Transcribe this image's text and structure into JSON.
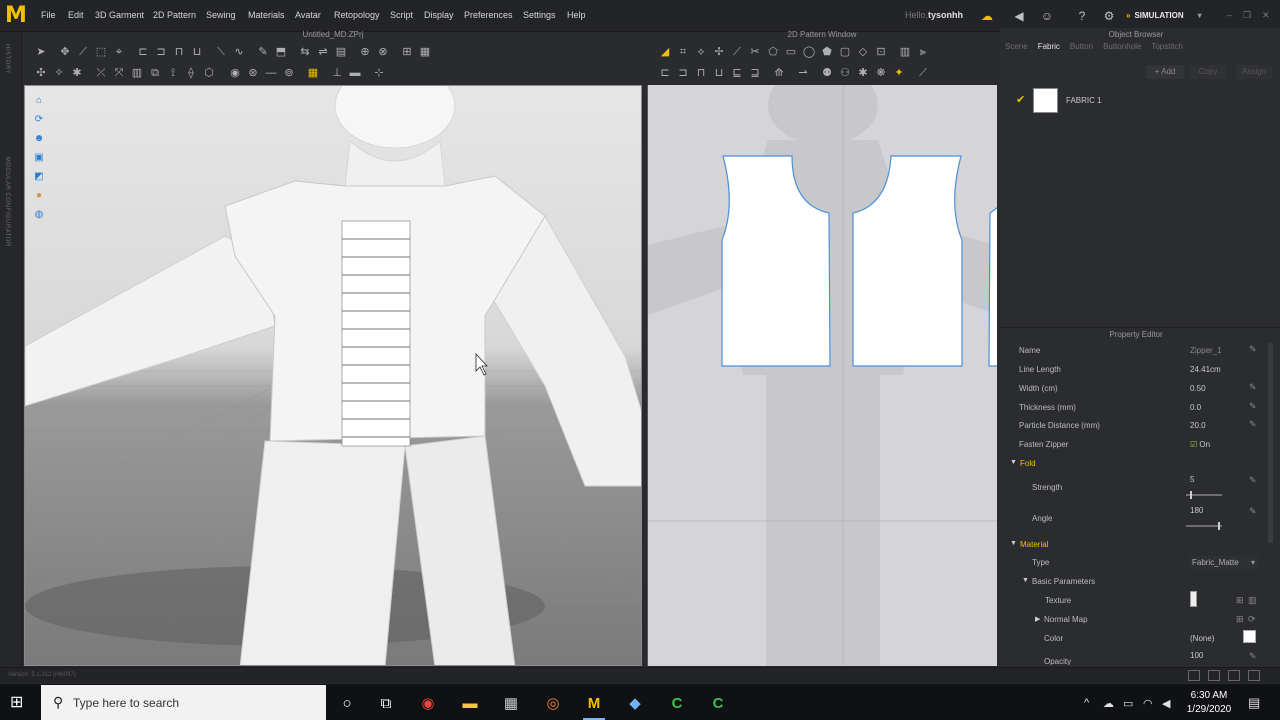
{
  "app": {
    "logo": "M",
    "menu": [
      "File",
      "Edit",
      "3D Garment",
      "2D Pattern",
      "Sewing",
      "Materials",
      "Avatar",
      "Retopology",
      "Script",
      "Display",
      "Preferences",
      "Settings",
      "Help"
    ],
    "greeting": "Hello,",
    "username": "tysonhh",
    "mode_label": "SIMULATION"
  },
  "left_tabs": [
    "HISTORY",
    "MODULAR CONFIGURATOR"
  ],
  "viewport3d": {
    "title": "Untitled_MD.ZPrj"
  },
  "viewport2d": {
    "title": "2D Pattern Window"
  },
  "object_browser": {
    "title": "Object Browser",
    "tabs": [
      "Scene",
      "Fabric",
      "Button",
      "Buttonhole",
      "Topstitch"
    ],
    "active_tab": "Fabric",
    "add_label": "+ Add",
    "copy_label": "Copy",
    "assign_label": "Assign",
    "fabric_item": "FABRIC 1",
    "fabric_color": "#ffffff"
  },
  "property_editor": {
    "title": "Property Editor",
    "name_label": "Name",
    "name_value": "Zipper_1",
    "line_length_label": "Line Length",
    "line_length_value": "24.41cm",
    "width_label": "Width (cm)",
    "width_value": "0.50",
    "thickness_label": "Thickness (mm)",
    "thickness_value": "0.0",
    "particle_label": "Particle Distance (mm)",
    "particle_value": "20.0",
    "fasten_label": "Fasten Zipper",
    "fasten_value": "On",
    "fold_label": "Fold",
    "strength_label": "Strength",
    "strength_value": "5",
    "strength_fraction": 0.1,
    "angle_label": "Angle",
    "angle_value": "180",
    "angle_fraction": 0.9,
    "material_label": "Material",
    "type_label": "Type",
    "type_value": "Fabric_Matte",
    "basic_label": "Basic Parameters",
    "texture_label": "Texture",
    "normal_label": "Normal Map",
    "color_label": "Color",
    "color_value": "(None)",
    "opacity_label": "Opacity",
    "opacity_value": "100"
  },
  "status": {
    "version": "Version: 5.1.312 (r46097)"
  },
  "taskbar": {
    "search_placeholder": "Type here to search",
    "time": "6:30 AM",
    "date": "1/29/2020"
  },
  "colors": {
    "accent": "#f0c000",
    "pattern_outline": "#4a90d9",
    "selection_blue": "#2a7fd0"
  }
}
